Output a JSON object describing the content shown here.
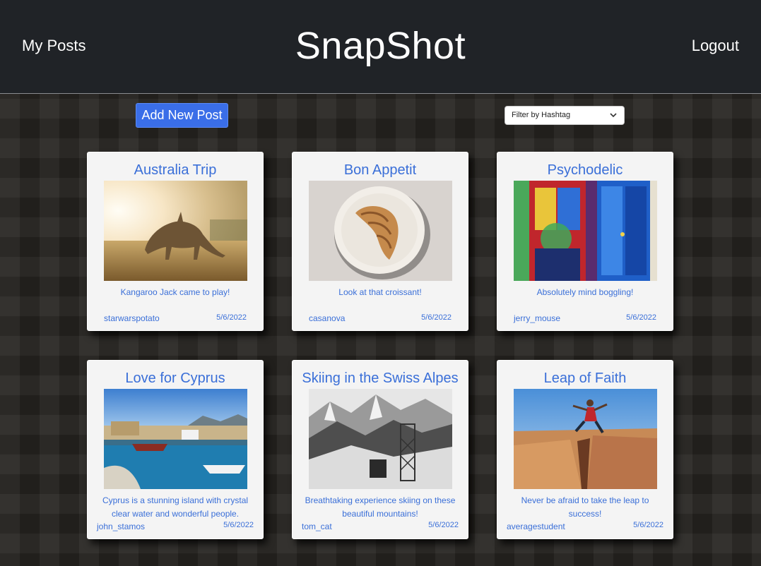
{
  "header": {
    "my_posts_label": "My Posts",
    "brand": "SnapShot",
    "logout_label": "Logout"
  },
  "toolbar": {
    "add_post_label": "Add New Post",
    "filter_placeholder": "Filter by Hashtag"
  },
  "posts": [
    {
      "title": "Australia Trip",
      "caption": "Kangaroo Jack came to play!",
      "user": "starwarspotato",
      "date": "5/6/2022",
      "image": "kangaroo-photo"
    },
    {
      "title": "Bon Appetit",
      "caption": "Look at that croissant!",
      "user": "casanova",
      "date": "5/6/2022",
      "image": "croissant-photo"
    },
    {
      "title": "Psychodelic",
      "caption": "Absolutely mind boggling!",
      "user": "jerry_mouse",
      "date": "5/6/2022",
      "image": "painted-doors-photo"
    },
    {
      "title": "Love for Cyprus",
      "caption": "Cyprus is a stunning island with crystal clear water and wonderful people.",
      "user": "john_stamos",
      "date": "5/6/2022",
      "image": "cyprus-harbor-photo"
    },
    {
      "title": "Skiing in the Swiss Alpes",
      "caption": "Breathtaking experience skiing on these beautiful mountains!",
      "user": "tom_cat",
      "date": "5/6/2022",
      "image": "swiss-alps-photo"
    },
    {
      "title": "Leap of Faith",
      "caption": "Never be afraid to take the leap to success!",
      "user": "averagestudent",
      "date": "5/6/2022",
      "image": "canyon-leap-photo"
    }
  ],
  "colors": {
    "accent": "#3a6fd8",
    "button": "#3a6ee8",
    "topbar": "#202327",
    "card": "#f4f4f4"
  }
}
